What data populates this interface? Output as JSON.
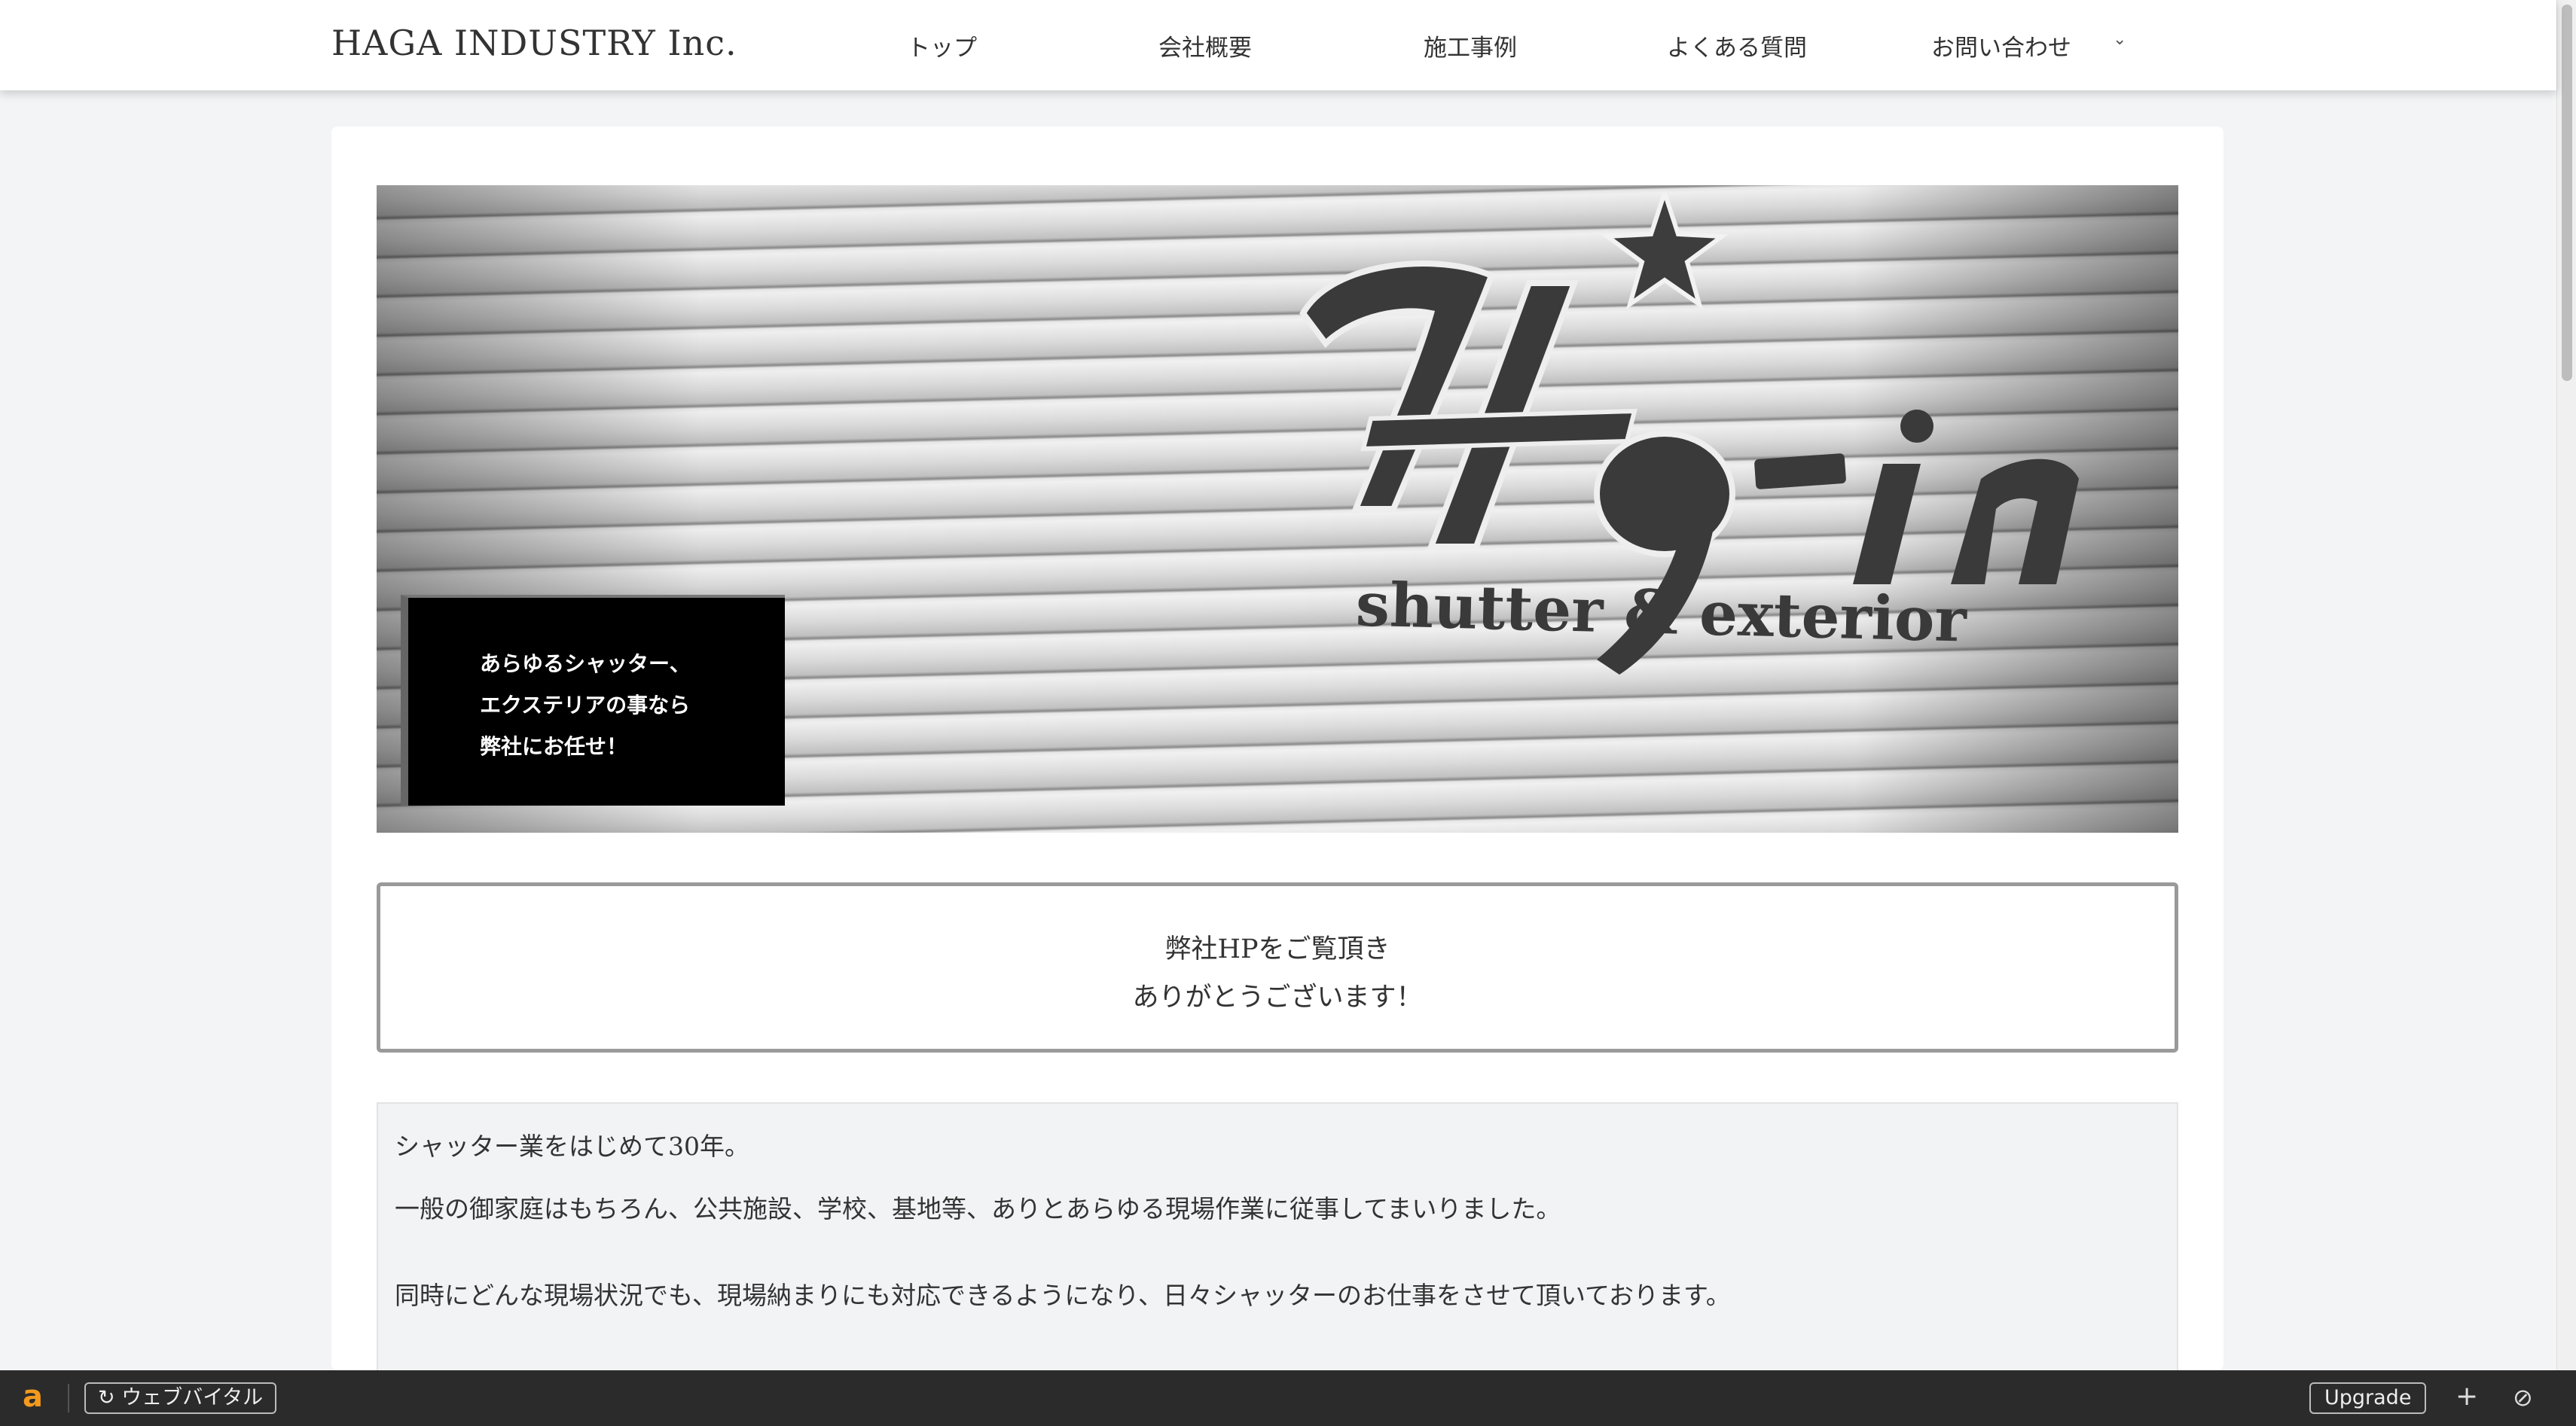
{
  "header": {
    "site_title": "HAGA INDUSTRY Inc.",
    "nav": [
      {
        "label": "トップ"
      },
      {
        "label": "会社概要"
      },
      {
        "label": "施工事例"
      },
      {
        "label": "よくある質問"
      },
      {
        "label": "お問い合わせ"
      }
    ],
    "caret": "⌄"
  },
  "hero": {
    "logo_script": "Hg-in",
    "logo_tagline": "shutter & exterior",
    "caption_lines": [
      "あらゆるシャッター、",
      "エクステリアの事なら",
      "弊社にお任せ！"
    ]
  },
  "thanks": {
    "lines": [
      "弊社HPをご覧頂き",
      "ありがとうございます！"
    ]
  },
  "intro": {
    "paragraphs": [
      "シャッター業をはじめて30年。",
      "一般の御家庭はもちろん、公共施設、学校、基地等、ありとあらゆる現場作業に従事してまいりました。",
      "同時にどんな現場状況でも、現場納まりにも対応できるようになり、日々シャッターのお仕事をさせて頂いております。"
    ]
  },
  "toolbar": {
    "logo": "a",
    "vitals_icon": "↻",
    "vitals_label": "ウェブバイタル",
    "upgrade_label": "Upgrade",
    "plus_icon": "+",
    "block_icon": "⊘"
  }
}
